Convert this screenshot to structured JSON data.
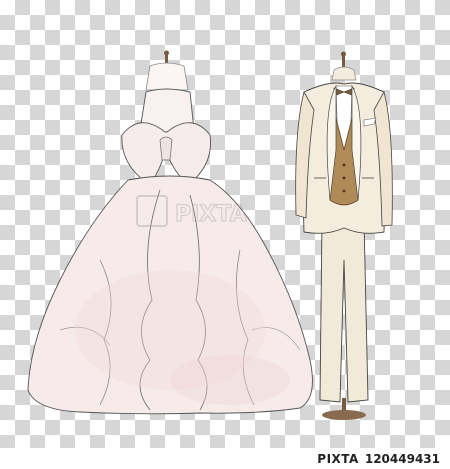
{
  "footer": {
    "logo_text": "PIXTA",
    "image_id": "120449431"
  },
  "watermark": {
    "text": "PIXTA"
  },
  "colors": {
    "checker_dark": "#d6d6d6",
    "dress": "#f7eeee",
    "suit": "#f2ead8",
    "vest": "#b08a57"
  }
}
